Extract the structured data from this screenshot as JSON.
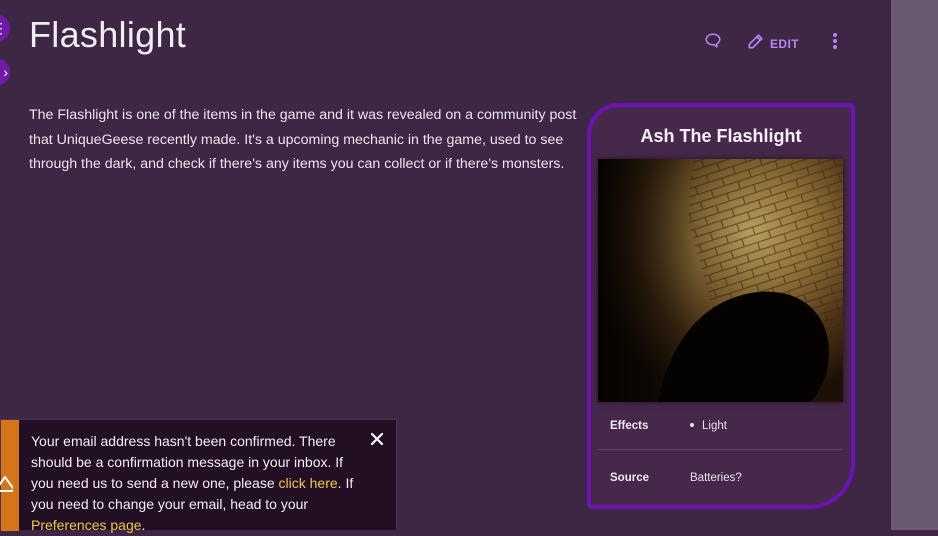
{
  "page": {
    "title": "Flashlight"
  },
  "actions": {
    "edit_label": "EDIT"
  },
  "side_tools": {
    "top_glyph": "⋮",
    "bottom_glyph": "›"
  },
  "article": {
    "body": "The Flashlight is one of the items in the game and it was revealed on a community post that UniqueGeese recently made. It's a upcoming mechanic in the game, used to see through the dark, and check if there's any items you can collect or if there's monsters."
  },
  "infobox": {
    "title": "Ash The Flashlight",
    "rows": [
      {
        "label": "Effects",
        "value": "Light"
      },
      {
        "label": "Source",
        "value": "Batteries?"
      }
    ]
  },
  "notice": {
    "icon": "warning-icon",
    "text_1": "Your email address hasn't been confirmed. There should be a confirmation message in your inbox. If you need us to send a new one, please",
    "link_1": "click here",
    "text_2": ". If you need to change your email, head to your",
    "link_2": "Preferences page",
    "text_3": "."
  },
  "colors": {
    "background": "#3e2744",
    "accent": "#b784f3",
    "infobox_border": "#6d12b6",
    "notice_stripe": "#d4751a",
    "link": "#f0c94a"
  }
}
